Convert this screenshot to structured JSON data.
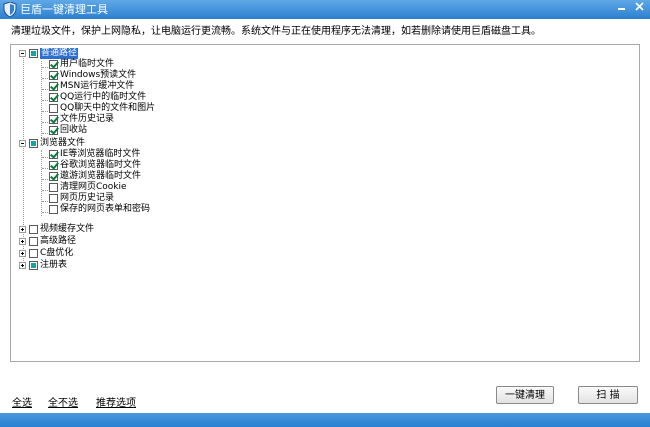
{
  "window": {
    "title": "巨盾一键清理工具"
  },
  "description": "清理垃圾文件，保护上网隐私，让电脑运行更流畅。系统文件与正在使用程序无法清理，如若删除请使用巨盾磁盘工具。",
  "tree": {
    "common": {
      "label": "普通路径",
      "items": [
        "用户临时文件",
        "Windows预读文件",
        "MSN运行缓冲文件",
        "QQ运行中的临时文件",
        "QQ聊天中的文件和图片",
        "文件历史记录",
        "回收站"
      ]
    },
    "browser": {
      "label": "浏览器文件",
      "items": [
        "IE等浏览器临时文件",
        "谷歌浏览器临时文件",
        "遨游浏览器临时文件",
        "清理网页Cookie",
        "网页历史记录",
        "保存的网页表单和密码"
      ]
    },
    "video": {
      "label": "视频缓存文件"
    },
    "advanced": {
      "label": "高级路径"
    },
    "c_drive": {
      "label": "C盘优化"
    },
    "registry": {
      "label": "注册表"
    }
  },
  "footer": {
    "select_all": "全选",
    "select_none": "全不选",
    "recommended": "推荐选项",
    "one_click_clean": "一键清理",
    "scan": "扫 描"
  },
  "colors": {
    "titlebar": "#2c7fd0",
    "check": "#0a7a3c",
    "partial": "#17a3a0",
    "selection": "#2c6fd0"
  }
}
